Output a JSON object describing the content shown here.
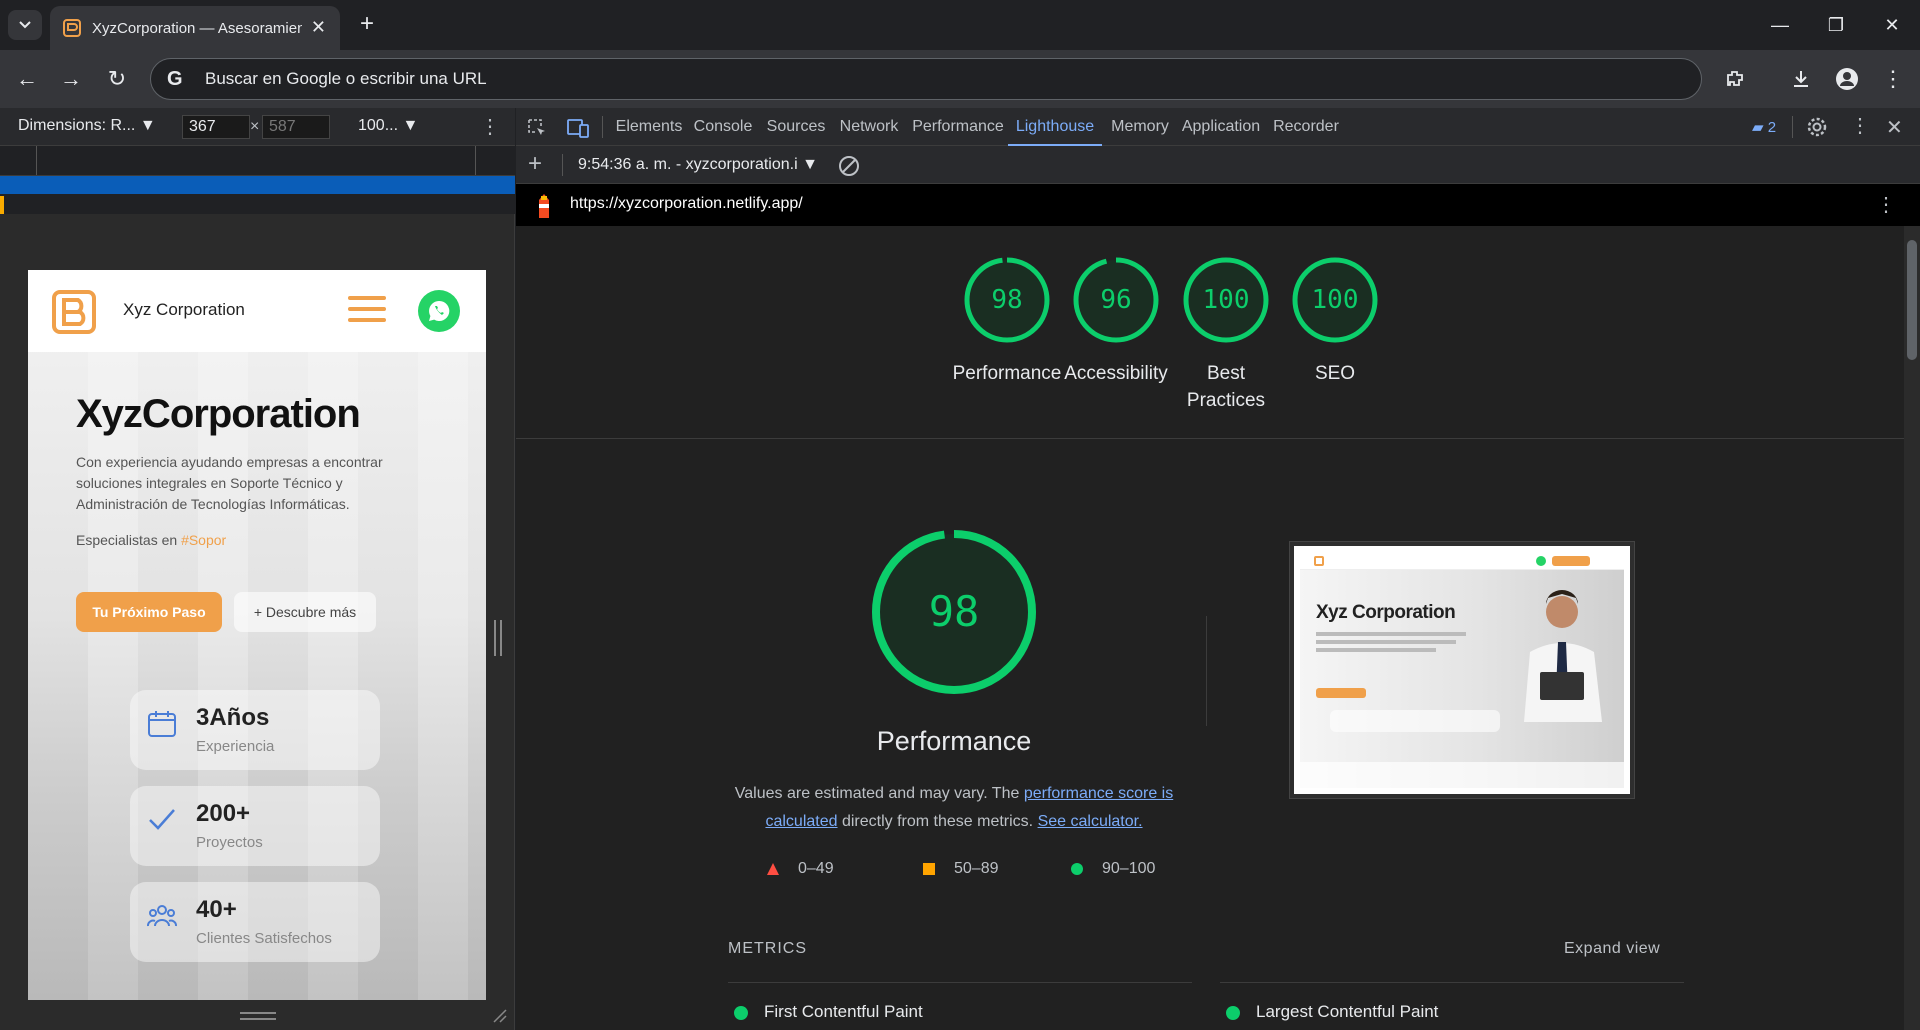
{
  "browser": {
    "tab_title": "XyzCorporation — Asesoramien",
    "omnibox_text": "Buscar en Google o escribir una URL"
  },
  "device_toolbar": {
    "dimensions_label": "Dimensions: R...",
    "width": "367",
    "height": "587",
    "times": "×",
    "zoom": "100..."
  },
  "site": {
    "name": "Xyz Corporation",
    "hero_title": "XyzCorporation",
    "hero_desc": "Con experiencia ayudando empresas a encontrar soluciones integrales en Soporte Técnico y Administración de Tecnologías Informáticas.",
    "spec_prefix": "Especialistas en",
    "spec_highlight": "#Sopor",
    "btn_primary": "Tu Próximo Paso",
    "btn_secondary": "+ Descubre más",
    "stats": [
      {
        "num": "3Años",
        "label": "Experiencia"
      },
      {
        "num": "200+",
        "label": "Proyectos"
      },
      {
        "num": "40+",
        "label": "Clientes Satisfechos"
      }
    ]
  },
  "devtools": {
    "tabs": [
      "Elements",
      "Console",
      "Sources",
      "Network",
      "Performance",
      "Lighthouse",
      "Memory",
      "Application",
      "Recorder"
    ],
    "active_tab": "Lighthouse",
    "issues_count": "2",
    "report_selector": "9:54:36 a. m. - xyzcorporation.i",
    "report_url": "https://xyzcorporation.netlify.app/"
  },
  "lighthouse": {
    "scores": [
      {
        "value": 98,
        "label": "Performance"
      },
      {
        "value": 96,
        "label": "Accessibility"
      },
      {
        "value": 100,
        "label": "Best Practices"
      },
      {
        "value": 100,
        "label": "SEO"
      }
    ],
    "performance": {
      "score": 98,
      "title": "Performance",
      "desc_prefix": "Values are estimated and may vary. The",
      "link1": "performance score is calculated",
      "desc_mid": "directly from these metrics.",
      "link2": "See calculator.",
      "legend": [
        {
          "range": "0–49",
          "color": "#ff4e42",
          "shape": "triangle"
        },
        {
          "range": "50–89",
          "color": "#ffa400",
          "shape": "square"
        },
        {
          "range": "90–100",
          "color": "#0cce6b",
          "shape": "circle"
        }
      ]
    },
    "screenshot_brand": "Xyz Corporation",
    "metrics_label": "METRICS",
    "expand_view": "Expand view",
    "metrics": [
      "First Contentful Paint",
      "Largest Contentful Paint"
    ],
    "pass_color": "#0cce6b"
  }
}
